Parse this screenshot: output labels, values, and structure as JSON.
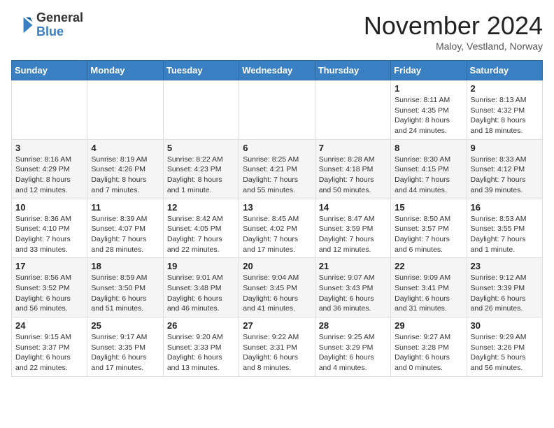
{
  "header": {
    "logo_line1": "General",
    "logo_line2": "Blue",
    "month_title": "November 2024",
    "location": "Maloy, Vestland, Norway"
  },
  "days_of_week": [
    "Sunday",
    "Monday",
    "Tuesday",
    "Wednesday",
    "Thursday",
    "Friday",
    "Saturday"
  ],
  "weeks": [
    [
      {
        "day": "",
        "info": ""
      },
      {
        "day": "",
        "info": ""
      },
      {
        "day": "",
        "info": ""
      },
      {
        "day": "",
        "info": ""
      },
      {
        "day": "",
        "info": ""
      },
      {
        "day": "1",
        "info": "Sunrise: 8:11 AM\nSunset: 4:35 PM\nDaylight: 8 hours and 24 minutes."
      },
      {
        "day": "2",
        "info": "Sunrise: 8:13 AM\nSunset: 4:32 PM\nDaylight: 8 hours and 18 minutes."
      }
    ],
    [
      {
        "day": "3",
        "info": "Sunrise: 8:16 AM\nSunset: 4:29 PM\nDaylight: 8 hours and 12 minutes."
      },
      {
        "day": "4",
        "info": "Sunrise: 8:19 AM\nSunset: 4:26 PM\nDaylight: 8 hours and 7 minutes."
      },
      {
        "day": "5",
        "info": "Sunrise: 8:22 AM\nSunset: 4:23 PM\nDaylight: 8 hours and 1 minute."
      },
      {
        "day": "6",
        "info": "Sunrise: 8:25 AM\nSunset: 4:21 PM\nDaylight: 7 hours and 55 minutes."
      },
      {
        "day": "7",
        "info": "Sunrise: 8:28 AM\nSunset: 4:18 PM\nDaylight: 7 hours and 50 minutes."
      },
      {
        "day": "8",
        "info": "Sunrise: 8:30 AM\nSunset: 4:15 PM\nDaylight: 7 hours and 44 minutes."
      },
      {
        "day": "9",
        "info": "Sunrise: 8:33 AM\nSunset: 4:12 PM\nDaylight: 7 hours and 39 minutes."
      }
    ],
    [
      {
        "day": "10",
        "info": "Sunrise: 8:36 AM\nSunset: 4:10 PM\nDaylight: 7 hours and 33 minutes."
      },
      {
        "day": "11",
        "info": "Sunrise: 8:39 AM\nSunset: 4:07 PM\nDaylight: 7 hours and 28 minutes."
      },
      {
        "day": "12",
        "info": "Sunrise: 8:42 AM\nSunset: 4:05 PM\nDaylight: 7 hours and 22 minutes."
      },
      {
        "day": "13",
        "info": "Sunrise: 8:45 AM\nSunset: 4:02 PM\nDaylight: 7 hours and 17 minutes."
      },
      {
        "day": "14",
        "info": "Sunrise: 8:47 AM\nSunset: 3:59 PM\nDaylight: 7 hours and 12 minutes."
      },
      {
        "day": "15",
        "info": "Sunrise: 8:50 AM\nSunset: 3:57 PM\nDaylight: 7 hours and 6 minutes."
      },
      {
        "day": "16",
        "info": "Sunrise: 8:53 AM\nSunset: 3:55 PM\nDaylight: 7 hours and 1 minute."
      }
    ],
    [
      {
        "day": "17",
        "info": "Sunrise: 8:56 AM\nSunset: 3:52 PM\nDaylight: 6 hours and 56 minutes."
      },
      {
        "day": "18",
        "info": "Sunrise: 8:59 AM\nSunset: 3:50 PM\nDaylight: 6 hours and 51 minutes."
      },
      {
        "day": "19",
        "info": "Sunrise: 9:01 AM\nSunset: 3:48 PM\nDaylight: 6 hours and 46 minutes."
      },
      {
        "day": "20",
        "info": "Sunrise: 9:04 AM\nSunset: 3:45 PM\nDaylight: 6 hours and 41 minutes."
      },
      {
        "day": "21",
        "info": "Sunrise: 9:07 AM\nSunset: 3:43 PM\nDaylight: 6 hours and 36 minutes."
      },
      {
        "day": "22",
        "info": "Sunrise: 9:09 AM\nSunset: 3:41 PM\nDaylight: 6 hours and 31 minutes."
      },
      {
        "day": "23",
        "info": "Sunrise: 9:12 AM\nSunset: 3:39 PM\nDaylight: 6 hours and 26 minutes."
      }
    ],
    [
      {
        "day": "24",
        "info": "Sunrise: 9:15 AM\nSunset: 3:37 PM\nDaylight: 6 hours and 22 minutes."
      },
      {
        "day": "25",
        "info": "Sunrise: 9:17 AM\nSunset: 3:35 PM\nDaylight: 6 hours and 17 minutes."
      },
      {
        "day": "26",
        "info": "Sunrise: 9:20 AM\nSunset: 3:33 PM\nDaylight: 6 hours and 13 minutes."
      },
      {
        "day": "27",
        "info": "Sunrise: 9:22 AM\nSunset: 3:31 PM\nDaylight: 6 hours and 8 minutes."
      },
      {
        "day": "28",
        "info": "Sunrise: 9:25 AM\nSunset: 3:29 PM\nDaylight: 6 hours and 4 minutes."
      },
      {
        "day": "29",
        "info": "Sunrise: 9:27 AM\nSunset: 3:28 PM\nDaylight: 6 hours and 0 minutes."
      },
      {
        "day": "30",
        "info": "Sunrise: 9:29 AM\nSunset: 3:26 PM\nDaylight: 5 hours and 56 minutes."
      }
    ]
  ]
}
